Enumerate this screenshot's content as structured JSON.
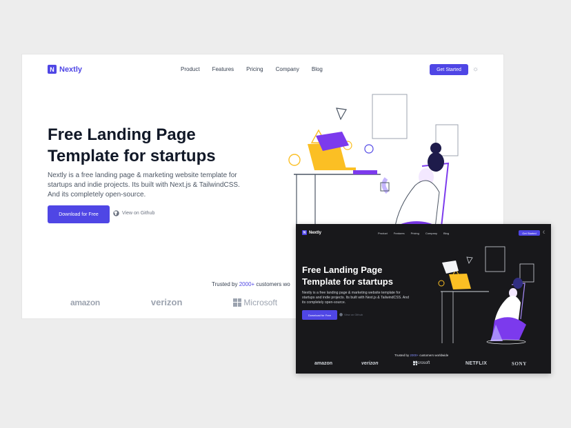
{
  "light": {
    "logo_letter": "N",
    "logo_text": "Nextly",
    "nav": [
      "Product",
      "Features",
      "Pricing",
      "Company",
      "Blog"
    ],
    "cta": "Get Started",
    "hero_title_1": "Free Landing Page",
    "hero_title_2": "Template for startups",
    "hero_desc": "Nextly is a free landing page & marketing website template for startups and indie projects. Its built with Next.js & TailwindCSS. And its completely open-source.",
    "primary_btn": "Download for Free",
    "github_btn": "View on Github",
    "trusted_pre": "Trusted by ",
    "trusted_count": "2000+",
    "trusted_post": " customers wo",
    "brands": [
      "amazon",
      "verizon",
      "Microsoft"
    ]
  },
  "dark": {
    "logo_letter": "N",
    "logo_text": "Nextly",
    "nav": [
      "Product",
      "Features",
      "Pricing",
      "Company",
      "Blog"
    ],
    "cta": "Get Started",
    "hero_title_1": "Free Landing Page",
    "hero_title_2": "Template for startups",
    "hero_desc": "Nextly is a free landing page & marketing website template for startups and indie projects. Its built with Next.js & TailwindCSS. And its completely open-source.",
    "primary_btn": "Download for Free",
    "github_btn": "View on Github",
    "trusted_pre": "Trusted by ",
    "trusted_count": "2000+",
    "trusted_post": " customers worldwide",
    "brands": [
      "amazon",
      "verizon",
      "Microsoft",
      "NETFLIX",
      "SONY"
    ]
  },
  "colors": {
    "accent": "#4f46e5",
    "illustration_purple": "#7c3aed",
    "illustration_light_purple": "#a78bfa",
    "illustration_yellow": "#fbbf24",
    "dark_bg": "#18181b",
    "page_bg": "#ededed"
  },
  "icons": [
    "logo-mark",
    "sun-icon",
    "moon-icon",
    "github-icon",
    "microsoft-logo-icon"
  ]
}
